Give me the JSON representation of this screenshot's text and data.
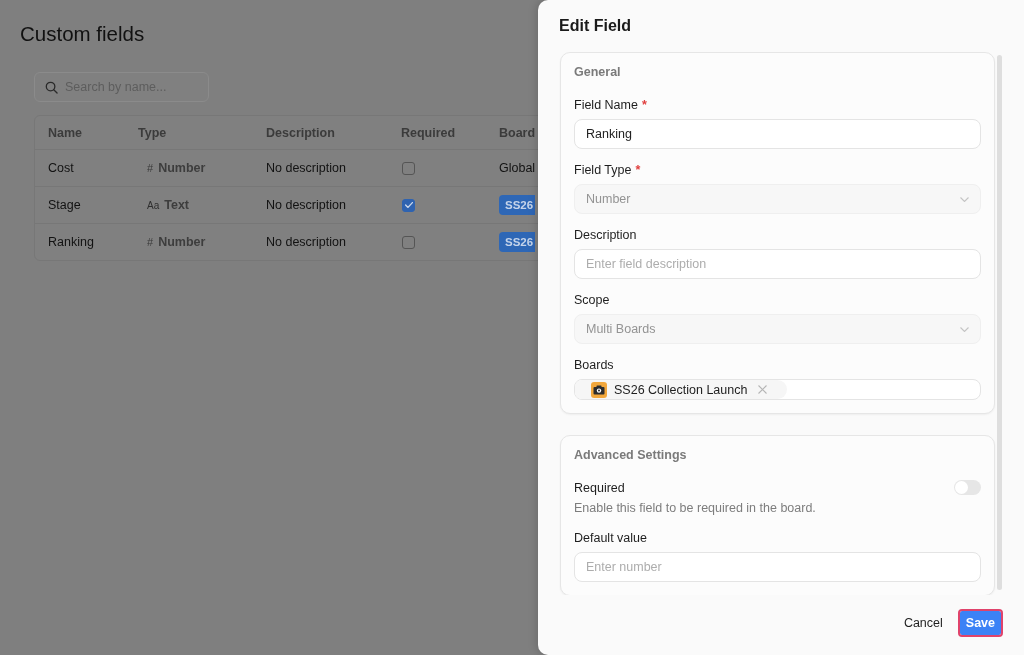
{
  "page": {
    "title": "Custom fields",
    "search": {
      "placeholder": "Search by name..."
    },
    "table": {
      "columns": [
        "Name",
        "Type",
        "Description",
        "Required",
        "Board"
      ],
      "rows": [
        {
          "name": "Cost",
          "type": {
            "kind": "number",
            "icon": "#",
            "label": "Number"
          },
          "description": "No description",
          "required": false,
          "board": {
            "kind": "plain",
            "label": "Global"
          }
        },
        {
          "name": "Stage",
          "type": {
            "kind": "text",
            "icon": "Aa",
            "label": "Text"
          },
          "description": "No description",
          "required": true,
          "board": {
            "kind": "badge",
            "label": "SS26"
          }
        },
        {
          "name": "Ranking",
          "type": {
            "kind": "number",
            "icon": "#",
            "label": "Number"
          },
          "description": "No description",
          "required": false,
          "board": {
            "kind": "badge",
            "label": "SS26"
          }
        }
      ]
    }
  },
  "edit_panel": {
    "title": "Edit Field",
    "sections": [
      {
        "title": "General",
        "fields": [
          {
            "kind": "input",
            "label": "Field Name",
            "required_mark": "*",
            "value": "Ranking"
          },
          {
            "kind": "select",
            "label": "Field Type",
            "required_mark": "*",
            "value": "Number",
            "disabled": true
          },
          {
            "kind": "input",
            "label": "Description",
            "placeholder": "Enter field description"
          },
          {
            "kind": "select",
            "label": "Scope",
            "value": "Multi Boards",
            "disabled": true
          },
          {
            "kind": "tags",
            "label": "Boards",
            "tags": [
              {
                "label": "SS26 Collection Launch"
              }
            ]
          }
        ]
      },
      {
        "title": "Advanced Settings",
        "fields": [
          {
            "kind": "toggle",
            "label": "Required",
            "help": "Enable this field to be required in the board.",
            "on": false
          },
          {
            "kind": "input",
            "label": "Default value",
            "placeholder": "Enter number"
          }
        ]
      }
    ],
    "buttons": [
      {
        "kind": "text",
        "label": "Cancel",
        "focused": false
      },
      {
        "kind": "primary",
        "label": "Save",
        "focused": true
      }
    ]
  }
}
